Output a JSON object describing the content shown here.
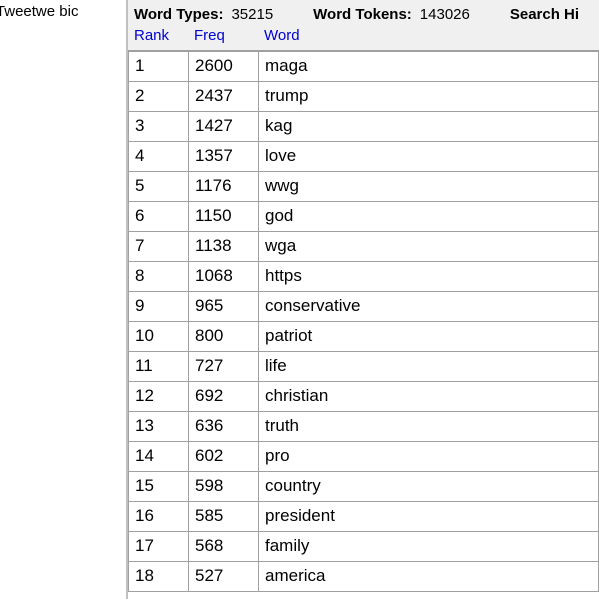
{
  "left_panel": {
    "filename_fragment": "tes Tweetwe bic"
  },
  "stats": {
    "word_types_label": "Word Types:",
    "word_types_value": "35215",
    "word_tokens_label": "Word Tokens:",
    "word_tokens_value": "143026",
    "search_label": "Search Hi"
  },
  "headers": {
    "rank": "Rank",
    "freq": "Freq",
    "word": "Word"
  },
  "rows": [
    {
      "rank": "1",
      "freq": "2600",
      "word": "maga"
    },
    {
      "rank": "2",
      "freq": "2437",
      "word": "trump"
    },
    {
      "rank": "3",
      "freq": "1427",
      "word": "kag"
    },
    {
      "rank": "4",
      "freq": "1357",
      "word": "love"
    },
    {
      "rank": "5",
      "freq": "1176",
      "word": "wwg"
    },
    {
      "rank": "6",
      "freq": "1150",
      "word": "god"
    },
    {
      "rank": "7",
      "freq": "1138",
      "word": "wga"
    },
    {
      "rank": "8",
      "freq": "1068",
      "word": "https"
    },
    {
      "rank": "9",
      "freq": "965",
      "word": "conservative"
    },
    {
      "rank": "10",
      "freq": "800",
      "word": "patriot"
    },
    {
      "rank": "11",
      "freq": "727",
      "word": "life"
    },
    {
      "rank": "12",
      "freq": "692",
      "word": "christian"
    },
    {
      "rank": "13",
      "freq": "636",
      "word": "truth"
    },
    {
      "rank": "14",
      "freq": "602",
      "word": "pro"
    },
    {
      "rank": "15",
      "freq": "598",
      "word": "country"
    },
    {
      "rank": "16",
      "freq": "585",
      "word": "president"
    },
    {
      "rank": "17",
      "freq": "568",
      "word": "family"
    },
    {
      "rank": "18",
      "freq": "527",
      "word": "america"
    }
  ]
}
